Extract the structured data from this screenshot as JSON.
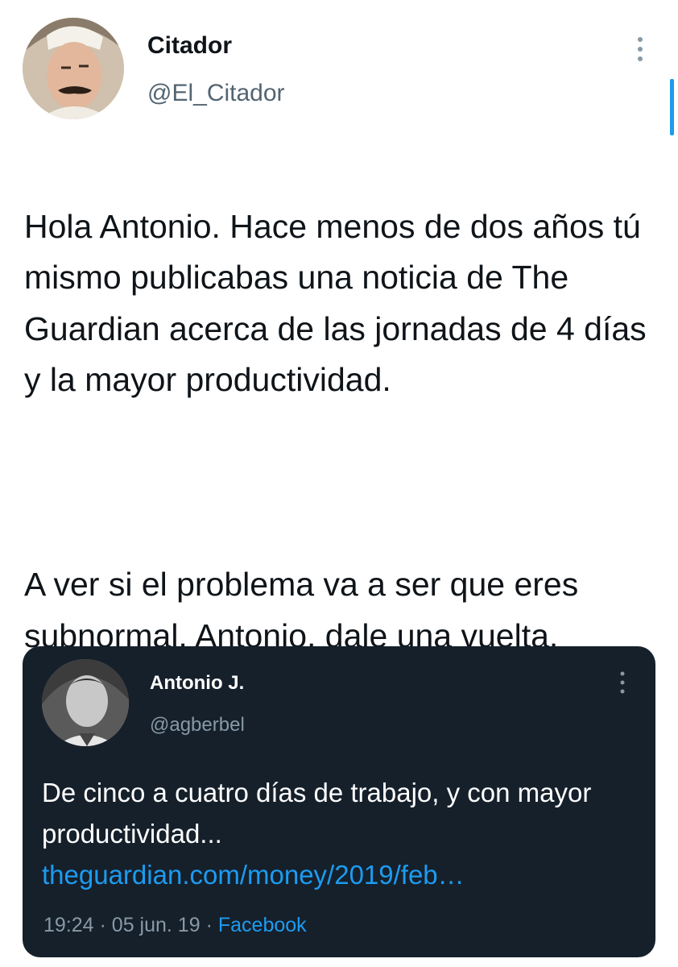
{
  "tweet": {
    "author": {
      "display_name": "Citador",
      "handle": "@El_Citador",
      "avatar_icon": "avatar-photo-icon"
    },
    "more_icon": "more-vertical-icon",
    "text_paragraphs": [
      "Hola Antonio. Hace menos de dos años tú mismo publicabas una noticia de The Guardian acerca de las jornadas de 4 días y la mayor productividad.",
      "A ver si el problema va a ser que eres subnormal, Antonio, dale una vuelta."
    ]
  },
  "quoted_tweet": {
    "author": {
      "display_name": "Antonio J.",
      "handle": "@agberbel"
    },
    "text": "De cinco a cuatro días de trabajo, y con mayor productividad...",
    "link_text": "theguardian.com/money/2019/feb…",
    "time": "19:24",
    "date": "05 jun. 19",
    "source": "Facebook",
    "separator": "·"
  },
  "colors": {
    "accent": "#1d9bf0",
    "text": "#0f1419",
    "secondary": "#536471",
    "card_bg": "#15202b",
    "card_secondary": "#8899a6"
  }
}
